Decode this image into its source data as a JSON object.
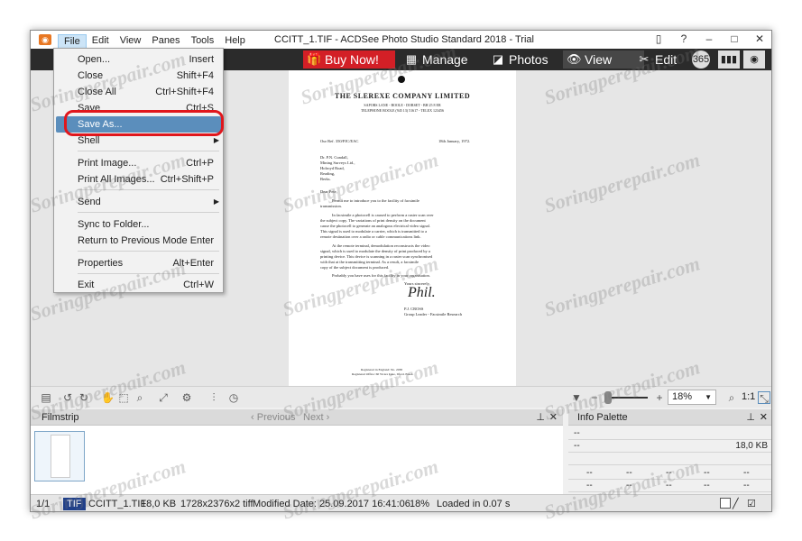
{
  "titlebar": {
    "menus": [
      "File",
      "Edit",
      "View",
      "Panes",
      "Tools",
      "Help"
    ],
    "title": "CCITT_1.TIF - ACDSee Photo Studio Standard 2018 - Trial"
  },
  "modes": {
    "buy_now": "Buy Now!",
    "manage": "Manage",
    "photos": "Photos",
    "view": "View",
    "edit": "Edit",
    "days": "365"
  },
  "file_menu": [
    {
      "label": "Open...",
      "shortcut": "Insert"
    },
    {
      "label": "Close",
      "shortcut": "Shift+F4"
    },
    {
      "label": "Close All",
      "shortcut": "Ctrl+Shift+F4"
    },
    {
      "label": "Save",
      "shortcut": "Ctrl+S"
    },
    {
      "label": "Save As...",
      "shortcut": ""
    },
    {
      "label": "Shell",
      "shortcut": ""
    },
    {
      "label": "Print Image...",
      "shortcut": "Ctrl+P"
    },
    {
      "label": "Print All Images...",
      "shortcut": "Ctrl+Shift+P"
    },
    {
      "label": "Send",
      "shortcut": ""
    },
    {
      "label": "Sync to Folder...",
      "shortcut": ""
    },
    {
      "label": "Return to Previous Mode",
      "shortcut": "Enter"
    },
    {
      "label": "Properties",
      "shortcut": "Alt+Enter"
    },
    {
      "label": "Exit",
      "shortcut": "Ctrl+W"
    }
  ],
  "document": {
    "company": "THE SLEREXE COMPANY LIMITED",
    "address1": "SAPORS LANE - BOOLE - DORSET - BH 25 8 ER",
    "address2": "TELEPHONE BOOLE (945 13) 51617 - TELEX 123456",
    "ref": "Our Ref. 350/PJC/EAC",
    "date": "18th January, 1972.",
    "to1": "Dr. P.N. Cundall,",
    "to2": "Mining Surveys Ltd.,",
    "to3": "Holroyd Road,",
    "to4": "Reading,",
    "to5": "Berks.",
    "salutation": "Dear Pete,",
    "p1a": "Permit me to introduce you to the facility of facsimile",
    "p1b": "transmission.",
    "p2a": "In facsimile a photocell is caused to perform a raster scan over",
    "p2b": "the subject copy. The variations of print density on the document",
    "p2c": "cause the photocell to generate an analogous electrical video signal.",
    "p2d": "This signal is used to modulate a carrier, which is transmitted to a",
    "p2e": "remote destination over a radio or cable communications link.",
    "p3a": "At the remote terminal, demodulation reconstructs the video",
    "p3b": "signal, which is used to modulate the density of print produced by a",
    "p3c": "printing device. This device is scanning in a raster scan synchronised",
    "p3d": "with that at the transmitting terminal. As a result, a facsimile",
    "p3e": "copy of the subject document is produced.",
    "p4": "Probably you have uses for this facility in your organisation.",
    "closing": "Yours sincerely,",
    "signature": "Phil.",
    "name": "P.J. CROSS",
    "role": "Group Leader - Facsimile Research",
    "foot1": "Registered in England:  No. 2038",
    "foot2": "Registered Office:  60 Vicara Lane, Ilford. Essex."
  },
  "toolbar2": {
    "zoom": "18%",
    "ratio": "1:1"
  },
  "filmstrip": {
    "title": "Filmstrip",
    "previous": "Previous",
    "next": "Next"
  },
  "info_palette": {
    "title": "Info Palette",
    "dash": "--",
    "size": "18,0 KB"
  },
  "statusbar": {
    "index": "1/1",
    "format": "TIF",
    "filename": "CCITT_1.TIF",
    "filesize": "18,0 KB",
    "dimensions": "1728x2376x2 tiff",
    "modified": "Modified Date: 25.09.2017 16:41:06",
    "zoom": "18%",
    "loaded": "Loaded in 0.07 s"
  },
  "watermark": "Soringperepair.com"
}
